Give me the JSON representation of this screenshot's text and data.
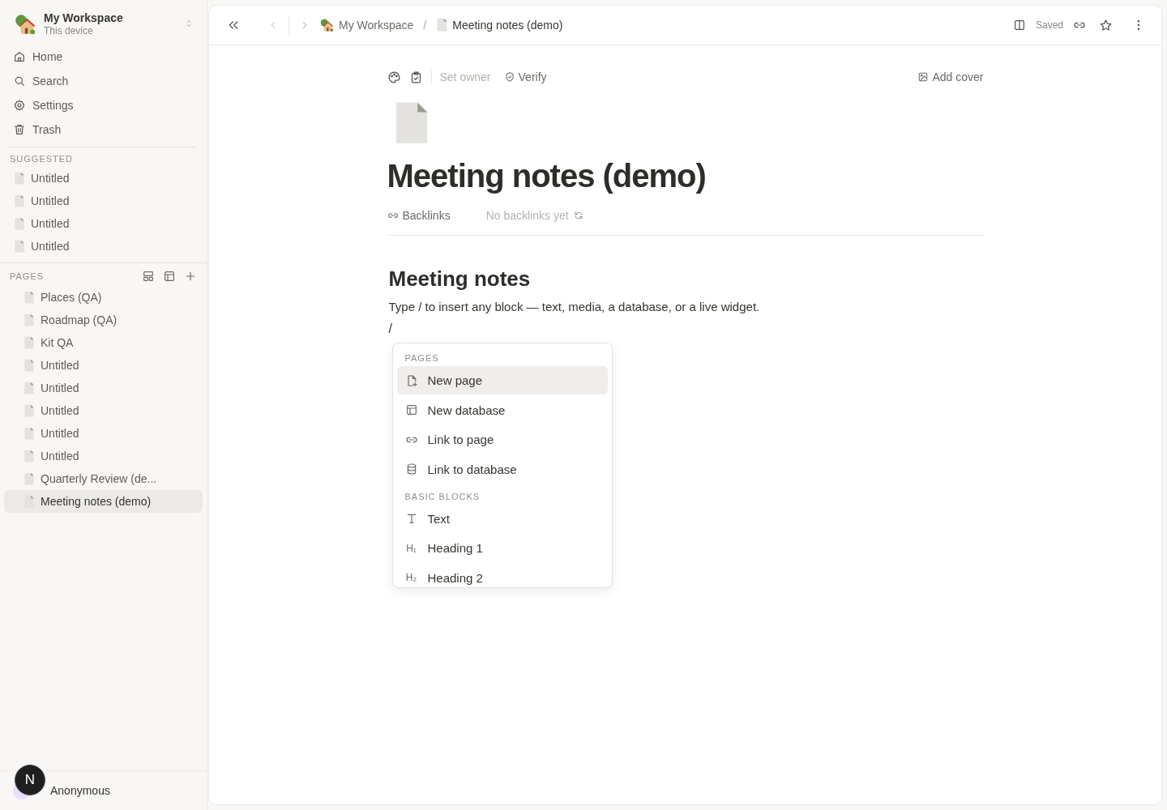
{
  "workspace": {
    "name": "My Workspace",
    "subtitle": "This device"
  },
  "nav": [
    "Home",
    "Search",
    "Settings",
    "Trash"
  ],
  "suggested": {
    "heading": "SUGGESTED",
    "items": [
      "Untitled",
      "Untitled",
      "Untitled",
      "Untitled"
    ]
  },
  "pages": {
    "heading": "PAGES",
    "items": [
      {
        "label": "Places (QA)",
        "selected": false
      },
      {
        "label": "Roadmap (QA)",
        "selected": false
      },
      {
        "label": "Kit QA",
        "selected": false
      },
      {
        "label": "Untitled",
        "selected": false
      },
      {
        "label": "Untitled",
        "selected": false
      },
      {
        "label": "Untitled",
        "selected": false
      },
      {
        "label": "Untitled",
        "selected": false
      },
      {
        "label": "Untitled",
        "selected": false
      },
      {
        "label": "Quarterly Review (de...",
        "selected": false
      },
      {
        "label": "Meeting notes (demo)",
        "selected": true
      }
    ]
  },
  "user": {
    "name": "Anonymous"
  },
  "dev_badge": "N",
  "breadcrumb": [
    {
      "label": "My Workspace",
      "kind": "workspace"
    },
    {
      "label": "Meeting notes (demo)",
      "kind": "page"
    }
  ],
  "breadcrumb_separator": "/",
  "header": {
    "status": "Saved"
  },
  "page": {
    "owner": "Set owner",
    "verify": "Verify",
    "cover": "Add cover",
    "title": "Meeting notes (demo)",
    "backlinks": "Backlinks",
    "backlinks_empty": "No backlinks yet",
    "heading": "Meeting notes",
    "paragraph": "Type / to insert any block — text, media, a database, or a live widget.",
    "slash": "/"
  },
  "slash_menu": {
    "sections": [
      {
        "heading": "PAGES",
        "items": [
          {
            "label": "New page",
            "kind": "page",
            "selected": true
          },
          {
            "label": "New database",
            "kind": "database",
            "selected": false
          },
          {
            "label": "Link to page",
            "kind": "link",
            "selected": false
          },
          {
            "label": "Link to database",
            "kind": "database_link",
            "selected": false
          }
        ]
      },
      {
        "heading": "BASIC BLOCKS",
        "items": [
          {
            "label": "Text",
            "kind": "text",
            "selected": false
          },
          {
            "label": "Heading 1",
            "kind": "heading",
            "glyph": "H₁",
            "selected": false
          },
          {
            "label": "Heading 2",
            "kind": "heading",
            "glyph": "H₂",
            "selected": false
          }
        ]
      }
    ]
  }
}
